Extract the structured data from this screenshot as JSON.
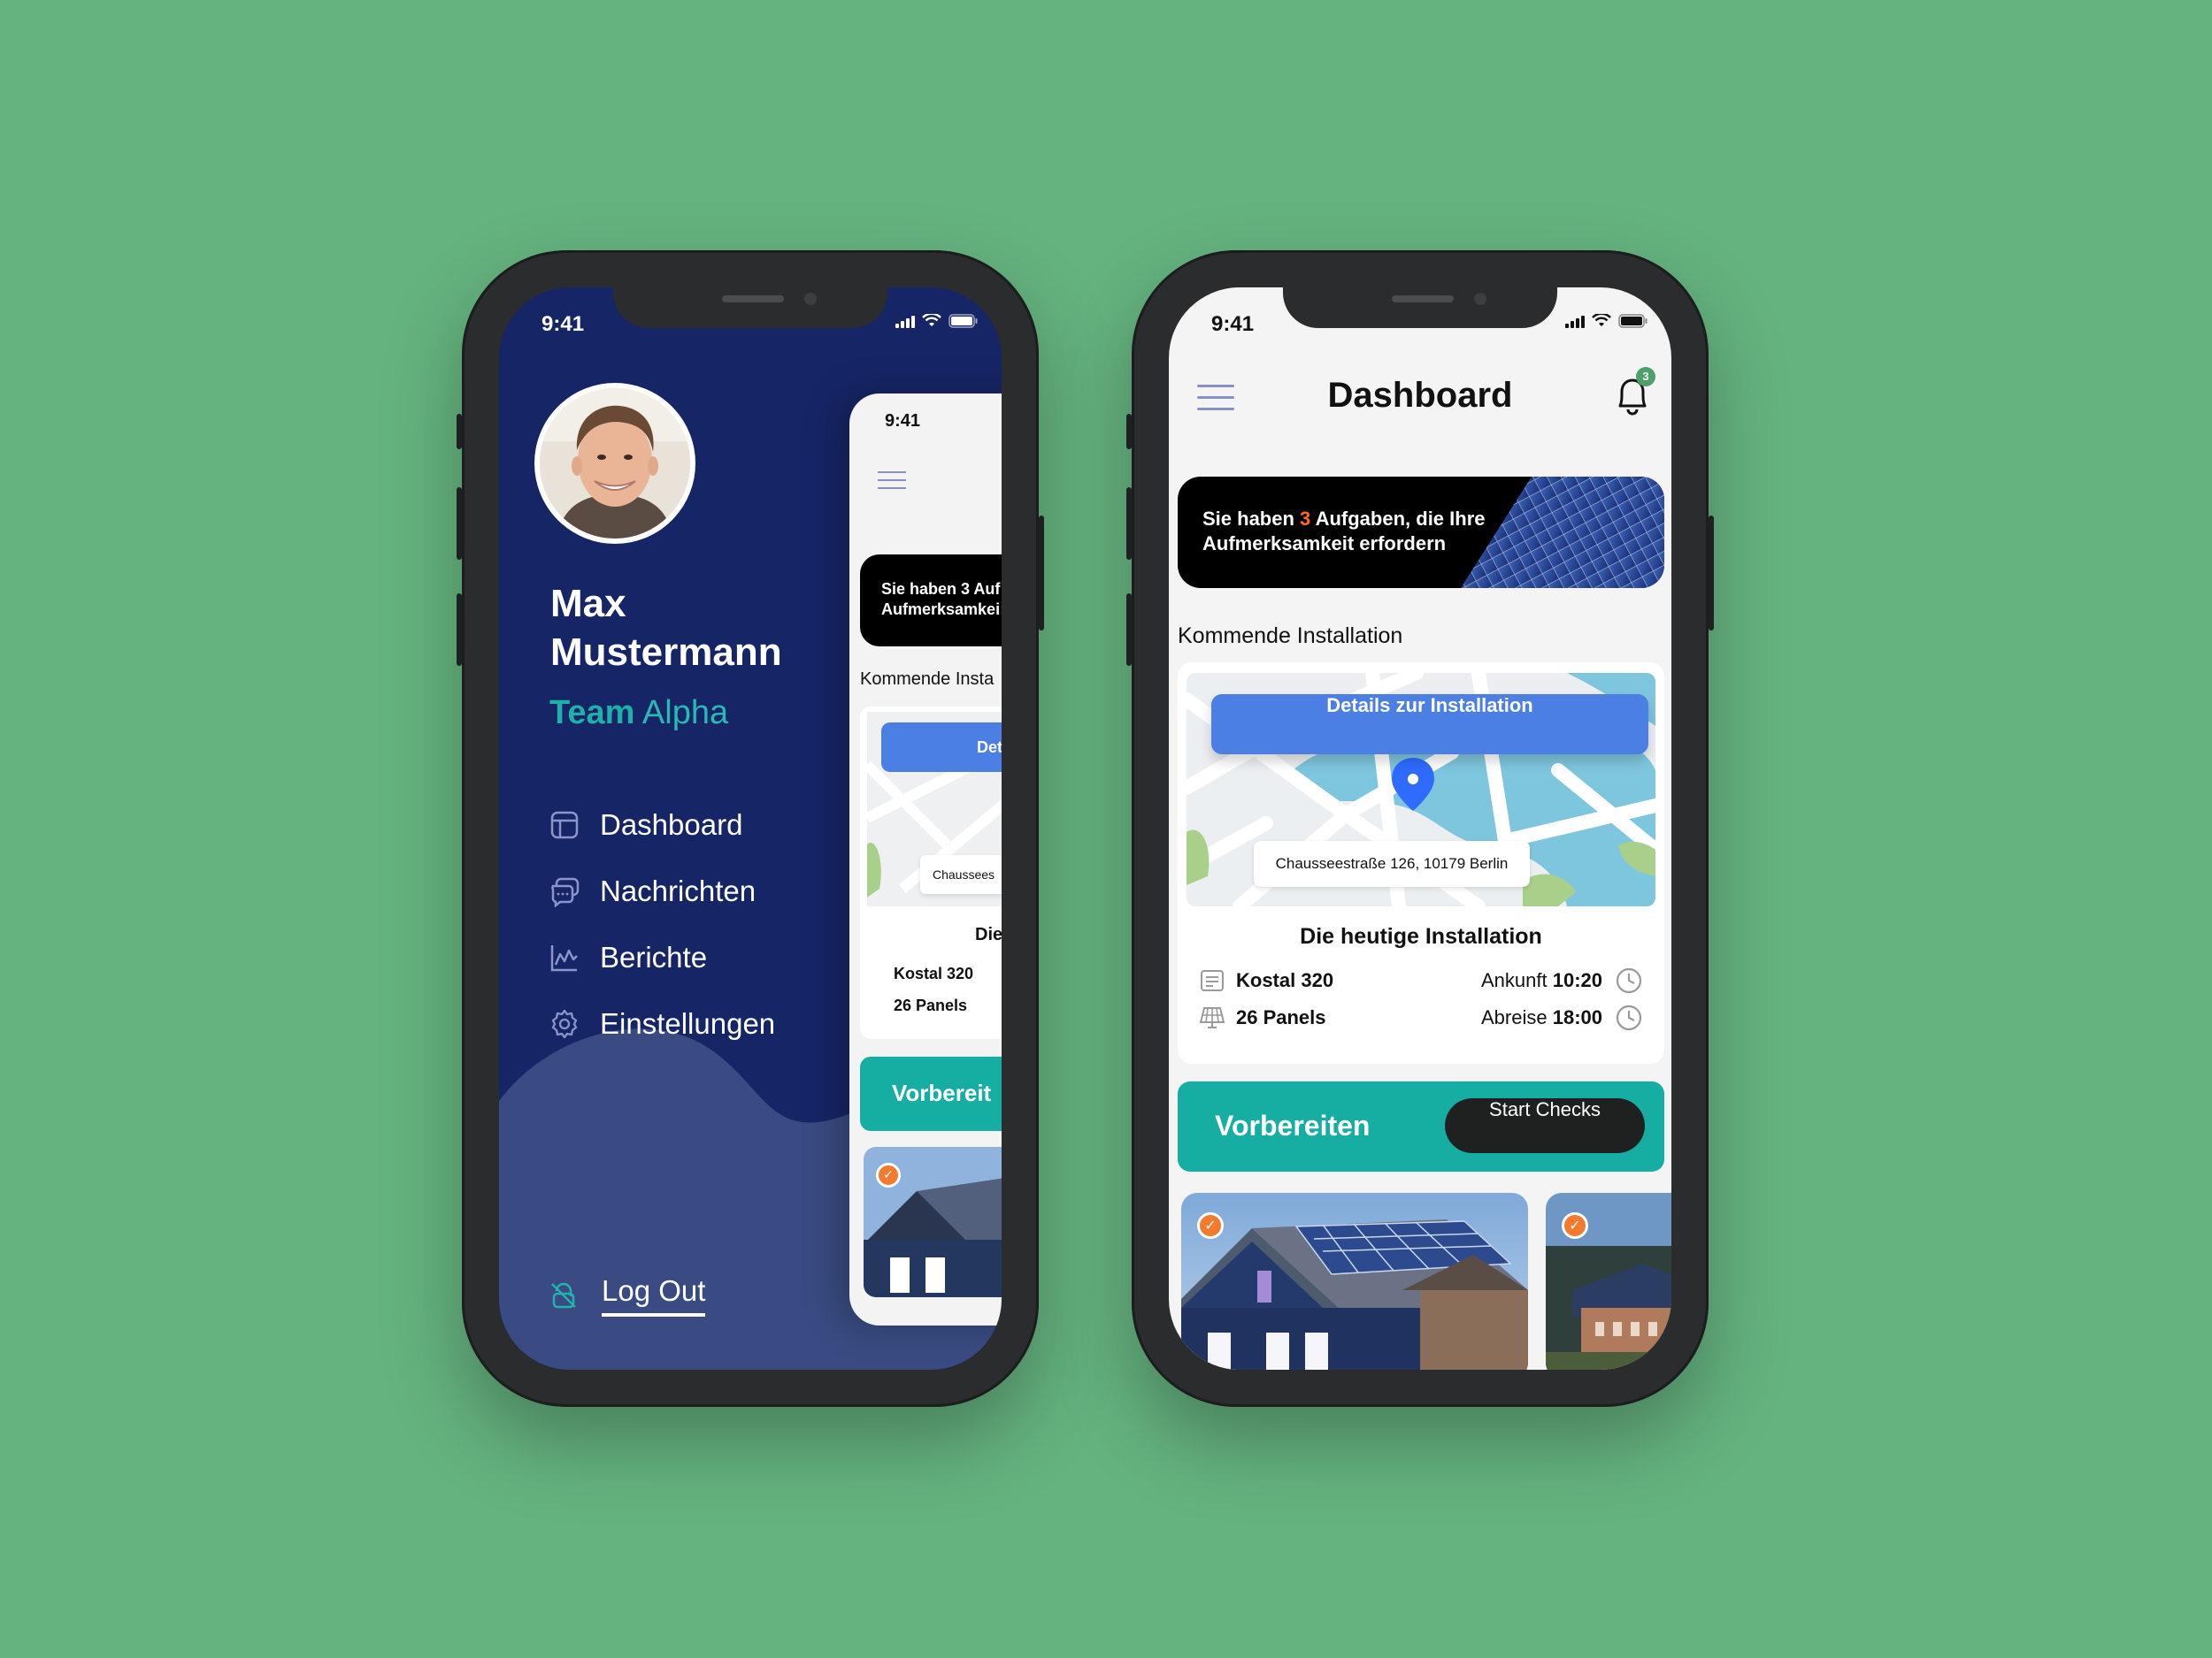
{
  "status_time": "9:41",
  "profile": {
    "name": "Max Mustermann",
    "team_prefix": "Team",
    "team_name": "Alpha"
  },
  "menu": {
    "items": [
      {
        "label": "Dashboard",
        "icon": "layout-icon"
      },
      {
        "label": "Nachrichten",
        "icon": "chat-icon"
      },
      {
        "label": "Berichte",
        "icon": "chart-icon"
      },
      {
        "label": "Einstellungen",
        "icon": "gear-icon"
      }
    ],
    "logout": "Log Out"
  },
  "dashboard": {
    "title": "Dashboard",
    "notification_count": "3",
    "banner": {
      "prefix": "Sie haben ",
      "count": "3",
      "suffix": " Aufgaben, die Ihre Aufmerksamkeit erfordern"
    },
    "section_title": "Kommende Installation",
    "details_button": "Details zur Installation",
    "address": "Chausseestraße 126, 10179 Berlin",
    "card_title": "Die heutige Installation",
    "inverter": "Kostal 320",
    "panels": "26 Panels",
    "arrival_label": "Ankunft",
    "arrival_time": "10:20",
    "departure_label": "Abreise",
    "departure_time": "18:00",
    "prepare_label": "Vorbereiten",
    "start_checks": "Start Checks"
  },
  "mini_preview": {
    "banner_line1": "Sie haben 3 Auf",
    "banner_line2": "Aufmerksamkei",
    "section": "Kommende Insta",
    "details": "Det",
    "address": "Chaussees",
    "card_title": "Die h",
    "inverter": "Kostal 320",
    "panels": "26 Panels",
    "prepare": "Vorbereit"
  },
  "colors": {
    "background": "#65b37f",
    "drawer": "#162566",
    "accent_teal": "#16aea3",
    "primary_blue": "#4b7fe4",
    "highlight_orange": "#ff6a1f"
  }
}
